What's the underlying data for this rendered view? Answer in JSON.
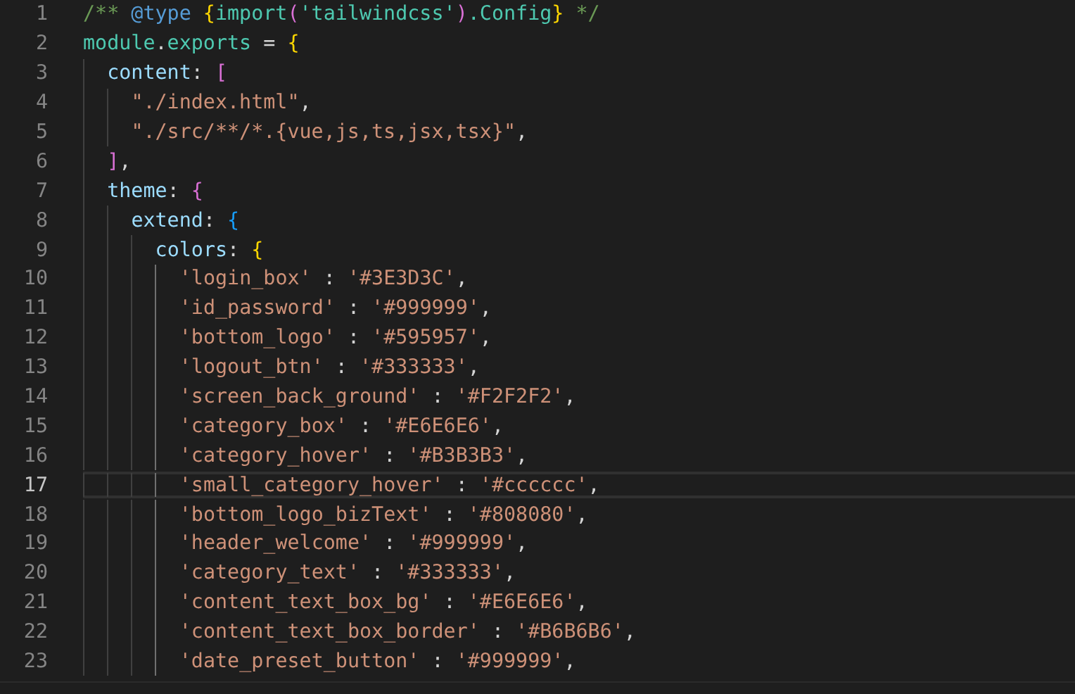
{
  "editor": {
    "lines": [
      {
        "number": "1",
        "current": false,
        "tokens": [
          {
            "kind": "comment",
            "text": "/** "
          },
          {
            "kind": "doctag",
            "text": "@type "
          },
          {
            "kind": "brace1",
            "text": "{"
          },
          {
            "kind": "type",
            "text": "import"
          },
          {
            "kind": "brace2",
            "text": "("
          },
          {
            "kind": "type",
            "text": "'tailwindcss'"
          },
          {
            "kind": "brace2",
            "text": ")"
          },
          {
            "kind": "type",
            "text": ".Config"
          },
          {
            "kind": "brace1",
            "text": "}"
          },
          {
            "kind": "comment",
            "text": " */"
          }
        ]
      },
      {
        "number": "2",
        "current": false,
        "tokens": [
          {
            "kind": "type",
            "text": "module"
          },
          {
            "kind": "plain",
            "text": "."
          },
          {
            "kind": "type",
            "text": "exports"
          },
          {
            "kind": "plain",
            "text": " = "
          },
          {
            "kind": "brace1",
            "text": "{"
          }
        ],
        "children": [
          {
            "number": "3",
            "current": false,
            "tokens": [
              {
                "kind": "property",
                "text": "content"
              },
              {
                "kind": "plain",
                "text": ": "
              },
              {
                "kind": "brace2",
                "text": "["
              }
            ],
            "children": [
              {
                "number": "4",
                "current": false,
                "tokens": [
                  {
                    "kind": "string",
                    "text": "\"./index.html\""
                  },
                  {
                    "kind": "plain",
                    "text": ","
                  }
                ]
              },
              {
                "number": "5",
                "current": false,
                "tokens": [
                  {
                    "kind": "string",
                    "text": "\"./src/**/*.{vue,js,ts,jsx,tsx}\""
                  },
                  {
                    "kind": "plain",
                    "text": ","
                  }
                ]
              }
            ]
          },
          {
            "number": "6",
            "current": false,
            "tokens": [
              {
                "kind": "brace2",
                "text": "]"
              },
              {
                "kind": "plain",
                "text": ","
              }
            ]
          },
          {
            "number": "7",
            "current": false,
            "tokens": [
              {
                "kind": "property",
                "text": "theme"
              },
              {
                "kind": "plain",
                "text": ": "
              },
              {
                "kind": "brace2",
                "text": "{"
              }
            ],
            "children": [
              {
                "number": "8",
                "current": false,
                "tokens": [
                  {
                    "kind": "property",
                    "text": "extend"
                  },
                  {
                    "kind": "plain",
                    "text": ": "
                  },
                  {
                    "kind": "brace3",
                    "text": "{"
                  }
                ],
                "children": [
                  {
                    "number": "9",
                    "current": false,
                    "tokens": [
                      {
                        "kind": "property",
                        "text": "colors"
                      },
                      {
                        "kind": "plain",
                        "text": ": "
                      },
                      {
                        "kind": "brace1",
                        "text": "{"
                      }
                    ],
                    "children": [
                      {
                        "number": "10",
                        "current": false,
                        "tokens": [
                          {
                            "kind": "string",
                            "text": "'login_box'"
                          },
                          {
                            "kind": "plain",
                            "text": " : "
                          },
                          {
                            "kind": "string",
                            "text": "'#3E3D3C'"
                          },
                          {
                            "kind": "plain",
                            "text": ","
                          }
                        ]
                      },
                      {
                        "number": "11",
                        "current": false,
                        "tokens": [
                          {
                            "kind": "string",
                            "text": "'id_password'"
                          },
                          {
                            "kind": "plain",
                            "text": " : "
                          },
                          {
                            "kind": "string",
                            "text": "'#999999'"
                          },
                          {
                            "kind": "plain",
                            "text": ","
                          }
                        ]
                      },
                      {
                        "number": "12",
                        "current": false,
                        "tokens": [
                          {
                            "kind": "string",
                            "text": "'bottom_logo'"
                          },
                          {
                            "kind": "plain",
                            "text": " : "
                          },
                          {
                            "kind": "string",
                            "text": "'#595957'"
                          },
                          {
                            "kind": "plain",
                            "text": ","
                          }
                        ]
                      },
                      {
                        "number": "13",
                        "current": false,
                        "tokens": [
                          {
                            "kind": "string",
                            "text": "'logout_btn'"
                          },
                          {
                            "kind": "plain",
                            "text": " : "
                          },
                          {
                            "kind": "string",
                            "text": "'#333333'"
                          },
                          {
                            "kind": "plain",
                            "text": ","
                          }
                        ]
                      },
                      {
                        "number": "14",
                        "current": false,
                        "tokens": [
                          {
                            "kind": "string",
                            "text": "'screen_back_ground'"
                          },
                          {
                            "kind": "plain",
                            "text": " : "
                          },
                          {
                            "kind": "string",
                            "text": "'#F2F2F2'"
                          },
                          {
                            "kind": "plain",
                            "text": ","
                          }
                        ]
                      },
                      {
                        "number": "15",
                        "current": false,
                        "tokens": [
                          {
                            "kind": "string",
                            "text": "'category_box'"
                          },
                          {
                            "kind": "plain",
                            "text": " : "
                          },
                          {
                            "kind": "string",
                            "text": "'#E6E6E6'"
                          },
                          {
                            "kind": "plain",
                            "text": ","
                          }
                        ]
                      },
                      {
                        "number": "16",
                        "current": false,
                        "tokens": [
                          {
                            "kind": "string",
                            "text": "'category_hover'"
                          },
                          {
                            "kind": "plain",
                            "text": " : "
                          },
                          {
                            "kind": "string",
                            "text": "'#B3B3B3'"
                          },
                          {
                            "kind": "plain",
                            "text": ","
                          }
                        ]
                      },
                      {
                        "number": "17",
                        "current": true,
                        "tokens": [
                          {
                            "kind": "string",
                            "text": "'small_category_hover'"
                          },
                          {
                            "kind": "plain",
                            "text": " : "
                          },
                          {
                            "kind": "string",
                            "text": "'#cccccc'"
                          },
                          {
                            "kind": "plain",
                            "text": ","
                          }
                        ]
                      },
                      {
                        "number": "18",
                        "current": false,
                        "tokens": [
                          {
                            "kind": "string",
                            "text": "'bottom_logo_bizText'"
                          },
                          {
                            "kind": "plain",
                            "text": " : "
                          },
                          {
                            "kind": "string",
                            "text": "'#808080'"
                          },
                          {
                            "kind": "plain",
                            "text": ","
                          }
                        ]
                      },
                      {
                        "number": "19",
                        "current": false,
                        "tokens": [
                          {
                            "kind": "string",
                            "text": "'header_welcome'"
                          },
                          {
                            "kind": "plain",
                            "text": " : "
                          },
                          {
                            "kind": "string",
                            "text": "'#999999'"
                          },
                          {
                            "kind": "plain",
                            "text": ","
                          }
                        ]
                      },
                      {
                        "number": "20",
                        "current": false,
                        "tokens": [
                          {
                            "kind": "string",
                            "text": "'category_text'"
                          },
                          {
                            "kind": "plain",
                            "text": " : "
                          },
                          {
                            "kind": "string",
                            "text": "'#333333'"
                          },
                          {
                            "kind": "plain",
                            "text": ","
                          }
                        ]
                      },
                      {
                        "number": "21",
                        "current": false,
                        "tokens": [
                          {
                            "kind": "string",
                            "text": "'content_text_box_bg'"
                          },
                          {
                            "kind": "plain",
                            "text": " : "
                          },
                          {
                            "kind": "string",
                            "text": "'#E6E6E6'"
                          },
                          {
                            "kind": "plain",
                            "text": ","
                          }
                        ]
                      },
                      {
                        "number": "22",
                        "current": false,
                        "tokens": [
                          {
                            "kind": "string",
                            "text": "'content_text_box_border'"
                          },
                          {
                            "kind": "plain",
                            "text": " : "
                          },
                          {
                            "kind": "string",
                            "text": "'#B6B6B6'"
                          },
                          {
                            "kind": "plain",
                            "text": ","
                          }
                        ]
                      },
                      {
                        "number": "23",
                        "current": false,
                        "tokens": [
                          {
                            "kind": "string",
                            "text": "'date_preset_button'"
                          },
                          {
                            "kind": "plain",
                            "text": " : "
                          },
                          {
                            "kind": "string",
                            "text": "'#999999'"
                          },
                          {
                            "kind": "plain",
                            "text": ","
                          }
                        ]
                      }
                    ]
                  }
                ]
              }
            ]
          }
        ]
      }
    ]
  }
}
